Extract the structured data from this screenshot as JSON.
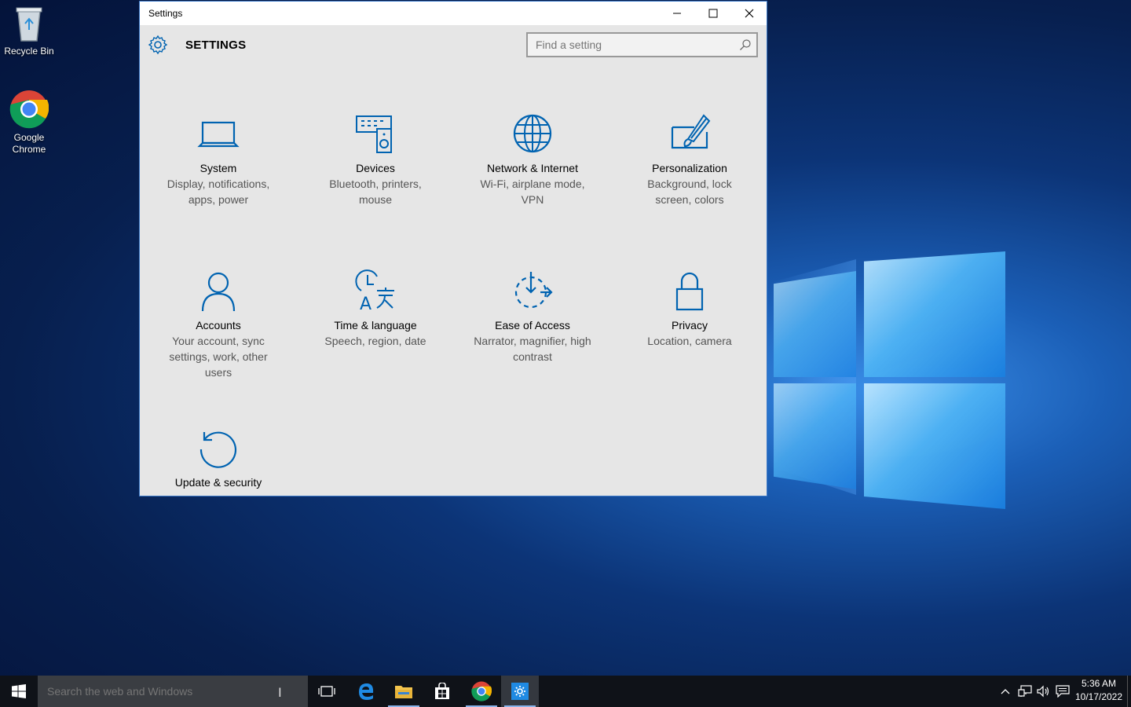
{
  "desktop": {
    "icons": [
      {
        "label": "Recycle Bin",
        "icon": "recycle-bin-icon"
      },
      {
        "label": "Google Chrome",
        "icon": "chrome-icon"
      }
    ]
  },
  "window": {
    "title": "Settings",
    "controls": {
      "minimize": "minimize-icon",
      "maximize": "maximize-icon",
      "close": "close-icon"
    },
    "header": {
      "title": "SETTINGS",
      "icon": "gear-icon"
    },
    "search": {
      "placeholder": "Find a setting",
      "value": ""
    },
    "categories": [
      {
        "name": "System",
        "desc": "Display, notifications, apps, power",
        "icon": "laptop-icon"
      },
      {
        "name": "Devices",
        "desc": "Bluetooth, printers, mouse",
        "icon": "devices-icon"
      },
      {
        "name": "Network & Internet",
        "desc": "Wi-Fi, airplane mode, VPN",
        "icon": "globe-icon"
      },
      {
        "name": "Personalization",
        "desc": "Background, lock screen, colors",
        "icon": "paint-brush-icon"
      },
      {
        "name": "Accounts",
        "desc": "Your account, sync settings, work, other users",
        "icon": "person-icon"
      },
      {
        "name": "Time & language",
        "desc": "Speech, region, date",
        "icon": "clock-language-icon"
      },
      {
        "name": "Ease of Access",
        "desc": "Narrator, magnifier, high contrast",
        "icon": "ease-of-access-icon"
      },
      {
        "name": "Privacy",
        "desc": "Location, camera",
        "icon": "lock-icon"
      },
      {
        "name": "Update & security",
        "desc": "",
        "icon": "update-icon"
      }
    ]
  },
  "taskbar": {
    "search": {
      "placeholder": "Search the web and Windows"
    },
    "apps": [
      {
        "name": "task-view",
        "icon": "task-view-icon"
      },
      {
        "name": "edge",
        "icon": "edge-icon"
      },
      {
        "name": "file-explorer",
        "icon": "folder-icon"
      },
      {
        "name": "store",
        "icon": "store-icon"
      },
      {
        "name": "chrome",
        "icon": "chrome-icon"
      },
      {
        "name": "settings",
        "icon": "gear-icon"
      }
    ],
    "tray": {
      "icons": [
        "chevron-up-icon",
        "network-icon",
        "volume-icon",
        "notification-icon"
      ]
    },
    "clock": {
      "time": "5:36 AM",
      "date": "10/17/2022"
    }
  },
  "colors": {
    "accent": "#0063b1",
    "window_bg": "#e6e6e6",
    "taskbar_bg": "#0f1218"
  }
}
